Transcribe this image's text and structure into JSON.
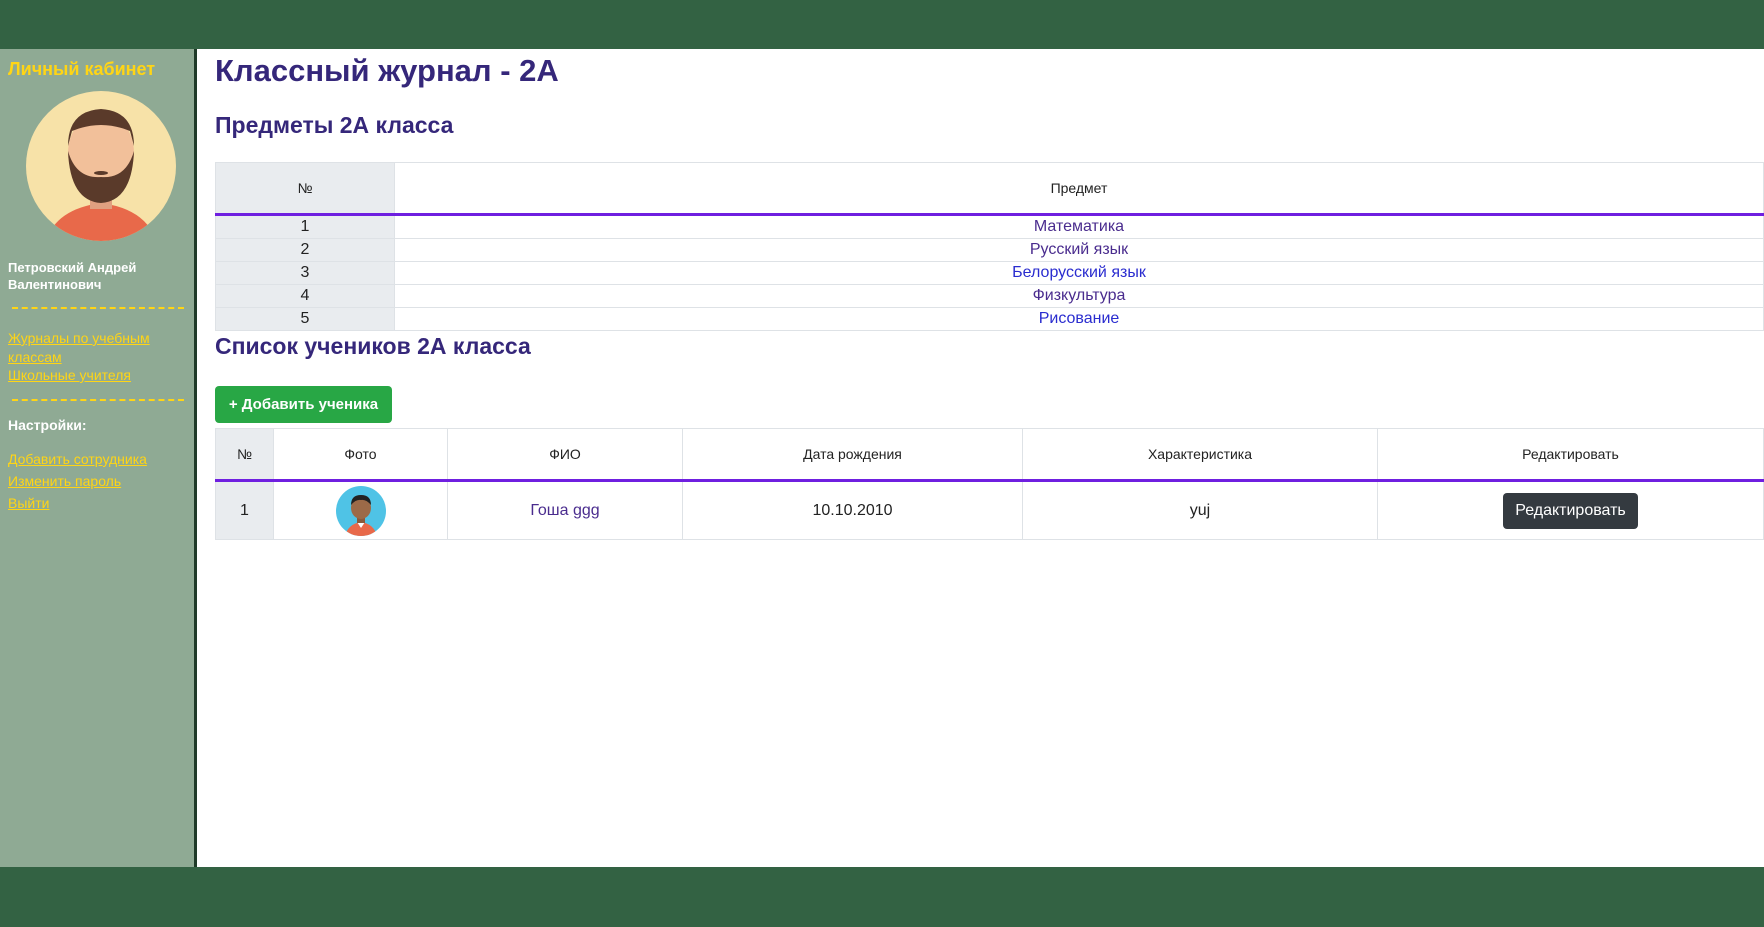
{
  "sidebar": {
    "title": "Личный кабинет",
    "user_name": "Петровский Андрей Валентинович",
    "links": [
      {
        "label": "Журналы по учебным классам"
      },
      {
        "label": "Школьные учителя"
      }
    ],
    "settings_label": "Настройки:",
    "settings_links": [
      {
        "label": "Добавить сотрудника"
      },
      {
        "label": "Изменить пароль"
      },
      {
        "label": "Выйти"
      }
    ]
  },
  "main": {
    "title": "Классный журнал - 2А",
    "subjects_title": "Предметы 2А класса",
    "subjects_table": {
      "headers": {
        "num": "№",
        "subject": "Предмет"
      },
      "rows": [
        {
          "num": "1",
          "subject": "Математика"
        },
        {
          "num": "2",
          "subject": "Русский язык"
        },
        {
          "num": "3",
          "subject": "Белорусский язык"
        },
        {
          "num": "4",
          "subject": "Физкультура"
        },
        {
          "num": "5",
          "subject": "Рисование"
        }
      ]
    },
    "students_title": "Список учеников 2А класса",
    "add_student_label": "+ Добавить ученика",
    "students_table": {
      "headers": {
        "num": "№",
        "photo": "Фото",
        "name": "ФИО",
        "birth": "Дата рождения",
        "info": "Характеристика",
        "edit": "Редактировать"
      },
      "rows": [
        {
          "num": "1",
          "name": "Гоша ggg",
          "birth": "10.10.2010",
          "info": "yuj",
          "edit_label": "Редактировать"
        }
      ]
    }
  },
  "colors": {
    "topbar": "#336243",
    "sidebar": "#8faa94",
    "accent_yellow": "#ffd515",
    "heading": "#35277a",
    "table_border_accent": "#6f1fe0",
    "add_button": "#28a745",
    "edit_button": "#343a40"
  }
}
